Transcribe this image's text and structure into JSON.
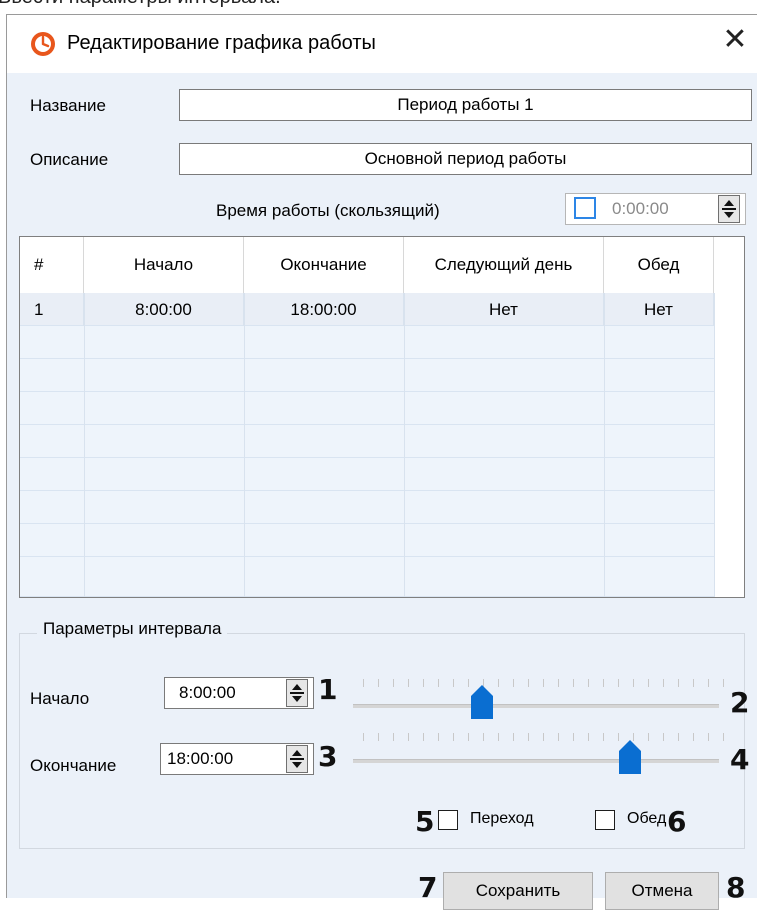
{
  "caption": "Ввести параметры интервала.",
  "window": {
    "title": "Редактирование графика работы",
    "close_glyph": "✕"
  },
  "form": {
    "name_label": "Название",
    "name_value": "Период работы 1",
    "description_label": "Описание",
    "description_value": "Основной период работы",
    "work_time_label": "Время работы (скользящий)",
    "work_time_value": "0:00:00",
    "work_time_checked": false
  },
  "table": {
    "columns": [
      "#",
      "Начало",
      "Окончание",
      "Следующий день",
      "Обед"
    ],
    "rows": [
      [
        "1",
        "8:00:00",
        "18:00:00",
        "Нет",
        "Нет"
      ]
    ]
  },
  "interval": {
    "group_title": "Параметры интервала",
    "start_label": "Начало",
    "start_value": "8:00:00",
    "start_slider_fraction": 0.333,
    "end_label": "Окончание",
    "end_value": "18:00:00",
    "end_slider_fraction": 0.75,
    "transition_label": "Переход",
    "transition_checked": false,
    "lunch_label": "Обед",
    "lunch_checked": false
  },
  "buttons": {
    "save": "Сохранить",
    "cancel": "Отмена"
  },
  "callouts": {
    "start_field": "1",
    "start_slider": "2",
    "end_field": "3",
    "end_slider": "4",
    "transition": "5",
    "lunch": "6",
    "save": "7",
    "cancel": "8"
  },
  "colors": {
    "client_bg": "#ebf1f9",
    "accent": "#0a6ed1",
    "checkbox_accent": "#2d86e6"
  }
}
